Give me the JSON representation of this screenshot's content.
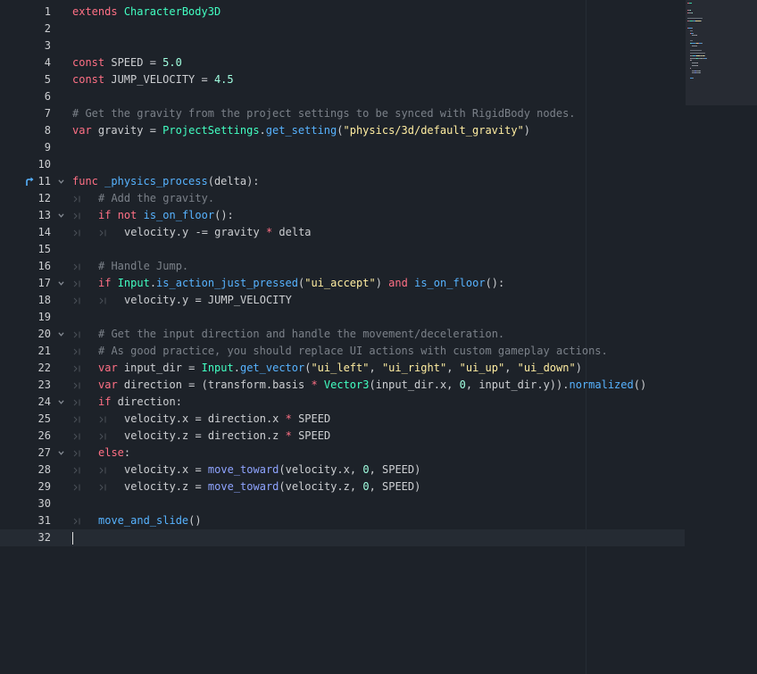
{
  "editor": {
    "lines": [
      {
        "n": "1",
        "tokens": [
          [
            "kw",
            "extends"
          ],
          [
            "tx",
            " "
          ],
          [
            "cl",
            "CharacterBody3D"
          ]
        ]
      },
      {
        "n": "2",
        "tokens": []
      },
      {
        "n": "3",
        "tokens": []
      },
      {
        "n": "4",
        "tokens": [
          [
            "kw",
            "const"
          ],
          [
            "tx",
            " SPEED = "
          ],
          [
            "nb",
            "5.0"
          ]
        ]
      },
      {
        "n": "5",
        "tokens": [
          [
            "kw",
            "const"
          ],
          [
            "tx",
            " JUMP_VELOCITY = "
          ],
          [
            "nb",
            "4.5"
          ]
        ]
      },
      {
        "n": "6",
        "tokens": []
      },
      {
        "n": "7",
        "tokens": [
          [
            "cm",
            "# Get the gravity from the project settings to be synced with RigidBody nodes."
          ]
        ]
      },
      {
        "n": "8",
        "tokens": [
          [
            "kw",
            "var"
          ],
          [
            "tx",
            " gravity = "
          ],
          [
            "cl",
            "ProjectSettings"
          ],
          [
            "tx",
            "."
          ],
          [
            "fn",
            "get_setting"
          ],
          [
            "tx",
            "("
          ],
          [
            "st",
            "\"physics/3d/default_gravity\""
          ],
          [
            "tx",
            ")"
          ]
        ]
      },
      {
        "n": "9",
        "tokens": []
      },
      {
        "n": "10",
        "tokens": []
      },
      {
        "n": "11",
        "tokens": [
          [
            "kw",
            "func"
          ],
          [
            "tx",
            " "
          ],
          [
            "fn",
            "_physics_process"
          ],
          [
            "tx",
            "(delta):"
          ]
        ]
      },
      {
        "n": "12",
        "tokens": [
          [
            "cm",
            "# Add the gravity."
          ]
        ]
      },
      {
        "n": "13",
        "tokens": [
          [
            "kw",
            "if"
          ],
          [
            "tx",
            " "
          ],
          [
            "kw",
            "not"
          ],
          [
            "tx",
            " "
          ],
          [
            "fn",
            "is_on_floor"
          ],
          [
            "tx",
            "():"
          ]
        ]
      },
      {
        "n": "14",
        "tokens": [
          [
            "tx",
            "velocity.y -= gravity "
          ],
          [
            "kw",
            "*"
          ],
          [
            "tx",
            " delta"
          ]
        ]
      },
      {
        "n": "15",
        "tokens": []
      },
      {
        "n": "16",
        "tokens": [
          [
            "cm",
            "# Handle Jump."
          ]
        ]
      },
      {
        "n": "17",
        "tokens": [
          [
            "kw",
            "if"
          ],
          [
            "tx",
            " "
          ],
          [
            "cl",
            "Input"
          ],
          [
            "tx",
            "."
          ],
          [
            "fn",
            "is_action_just_pressed"
          ],
          [
            "tx",
            "("
          ],
          [
            "st",
            "\"ui_accept\""
          ],
          [
            "tx",
            ") "
          ],
          [
            "kw",
            "and"
          ],
          [
            "tx",
            " "
          ],
          [
            "fn",
            "is_on_floor"
          ],
          [
            "tx",
            "():"
          ]
        ]
      },
      {
        "n": "18",
        "tokens": [
          [
            "tx",
            "velocity.y = JUMP_VELOCITY"
          ]
        ]
      },
      {
        "n": "19",
        "tokens": []
      },
      {
        "n": "20",
        "tokens": [
          [
            "cm",
            "# Get the input direction and handle the movement/deceleration."
          ]
        ]
      },
      {
        "n": "21",
        "tokens": [
          [
            "cm",
            "# As good practice, you should replace UI actions with custom gameplay actions."
          ]
        ]
      },
      {
        "n": "22",
        "tokens": [
          [
            "kw",
            "var"
          ],
          [
            "tx",
            " input_dir = "
          ],
          [
            "cl",
            "Input"
          ],
          [
            "tx",
            "."
          ],
          [
            "fn",
            "get_vector"
          ],
          [
            "tx",
            "("
          ],
          [
            "st",
            "\"ui_left\""
          ],
          [
            "tx",
            ", "
          ],
          [
            "st",
            "\"ui_right\""
          ],
          [
            "tx",
            ", "
          ],
          [
            "st",
            "\"ui_up\""
          ],
          [
            "tx",
            ", "
          ],
          [
            "st",
            "\"ui_down\""
          ],
          [
            "tx",
            ")"
          ]
        ]
      },
      {
        "n": "23",
        "tokens": [
          [
            "kw",
            "var"
          ],
          [
            "tx",
            " direction = (transform.basis "
          ],
          [
            "kw",
            "*"
          ],
          [
            "tx",
            " "
          ],
          [
            "cl",
            "Vector3"
          ],
          [
            "tx",
            "(input_dir.x, "
          ],
          [
            "nb",
            "0"
          ],
          [
            "tx",
            ", input_dir.y))."
          ],
          [
            "fn",
            "normalized"
          ],
          [
            "tx",
            "()"
          ]
        ]
      },
      {
        "n": "24",
        "tokens": [
          [
            "kw",
            "if"
          ],
          [
            "tx",
            " direction:"
          ]
        ]
      },
      {
        "n": "25",
        "tokens": [
          [
            "tx",
            "velocity.x = direction.x "
          ],
          [
            "kw",
            "*"
          ],
          [
            "tx",
            " SPEED"
          ]
        ]
      },
      {
        "n": "26",
        "tokens": [
          [
            "tx",
            "velocity.z = direction.z "
          ],
          [
            "kw",
            "*"
          ],
          [
            "tx",
            " SPEED"
          ]
        ]
      },
      {
        "n": "27",
        "tokens": [
          [
            "kw",
            "else"
          ],
          [
            "tx",
            ":"
          ]
        ]
      },
      {
        "n": "28",
        "tokens": [
          [
            "tx",
            "velocity.x = "
          ],
          [
            "mc",
            "move_toward"
          ],
          [
            "tx",
            "(velocity.x, "
          ],
          [
            "nb",
            "0"
          ],
          [
            "tx",
            ", SPEED)"
          ]
        ]
      },
      {
        "n": "29",
        "tokens": [
          [
            "tx",
            "velocity.z = "
          ],
          [
            "mc",
            "move_toward"
          ],
          [
            "tx",
            "(velocity.z, "
          ],
          [
            "nb",
            "0"
          ],
          [
            "tx",
            ", SPEED)"
          ]
        ]
      },
      {
        "n": "30",
        "tokens": []
      },
      {
        "n": "31",
        "tokens": [
          [
            "fn",
            "move_and_slide"
          ],
          [
            "tx",
            "()"
          ]
        ]
      },
      {
        "n": "32",
        "tokens": []
      }
    ]
  },
  "colors": {
    "background": "#1d2229",
    "current_line": "#252b33",
    "keyword": "#ff7085",
    "class": "#42ffc2",
    "number": "#a1ffe0",
    "function": "#57b3ff",
    "member_function": "#8fa4ff",
    "string": "#ffeda1",
    "comment": "#7b8189",
    "text": "#cdcfd2"
  },
  "icons": {
    "executing_line": "arrow-up-right-icon",
    "fold": "chevron-down-icon",
    "indent_guide": "tab-arrow-icon"
  }
}
